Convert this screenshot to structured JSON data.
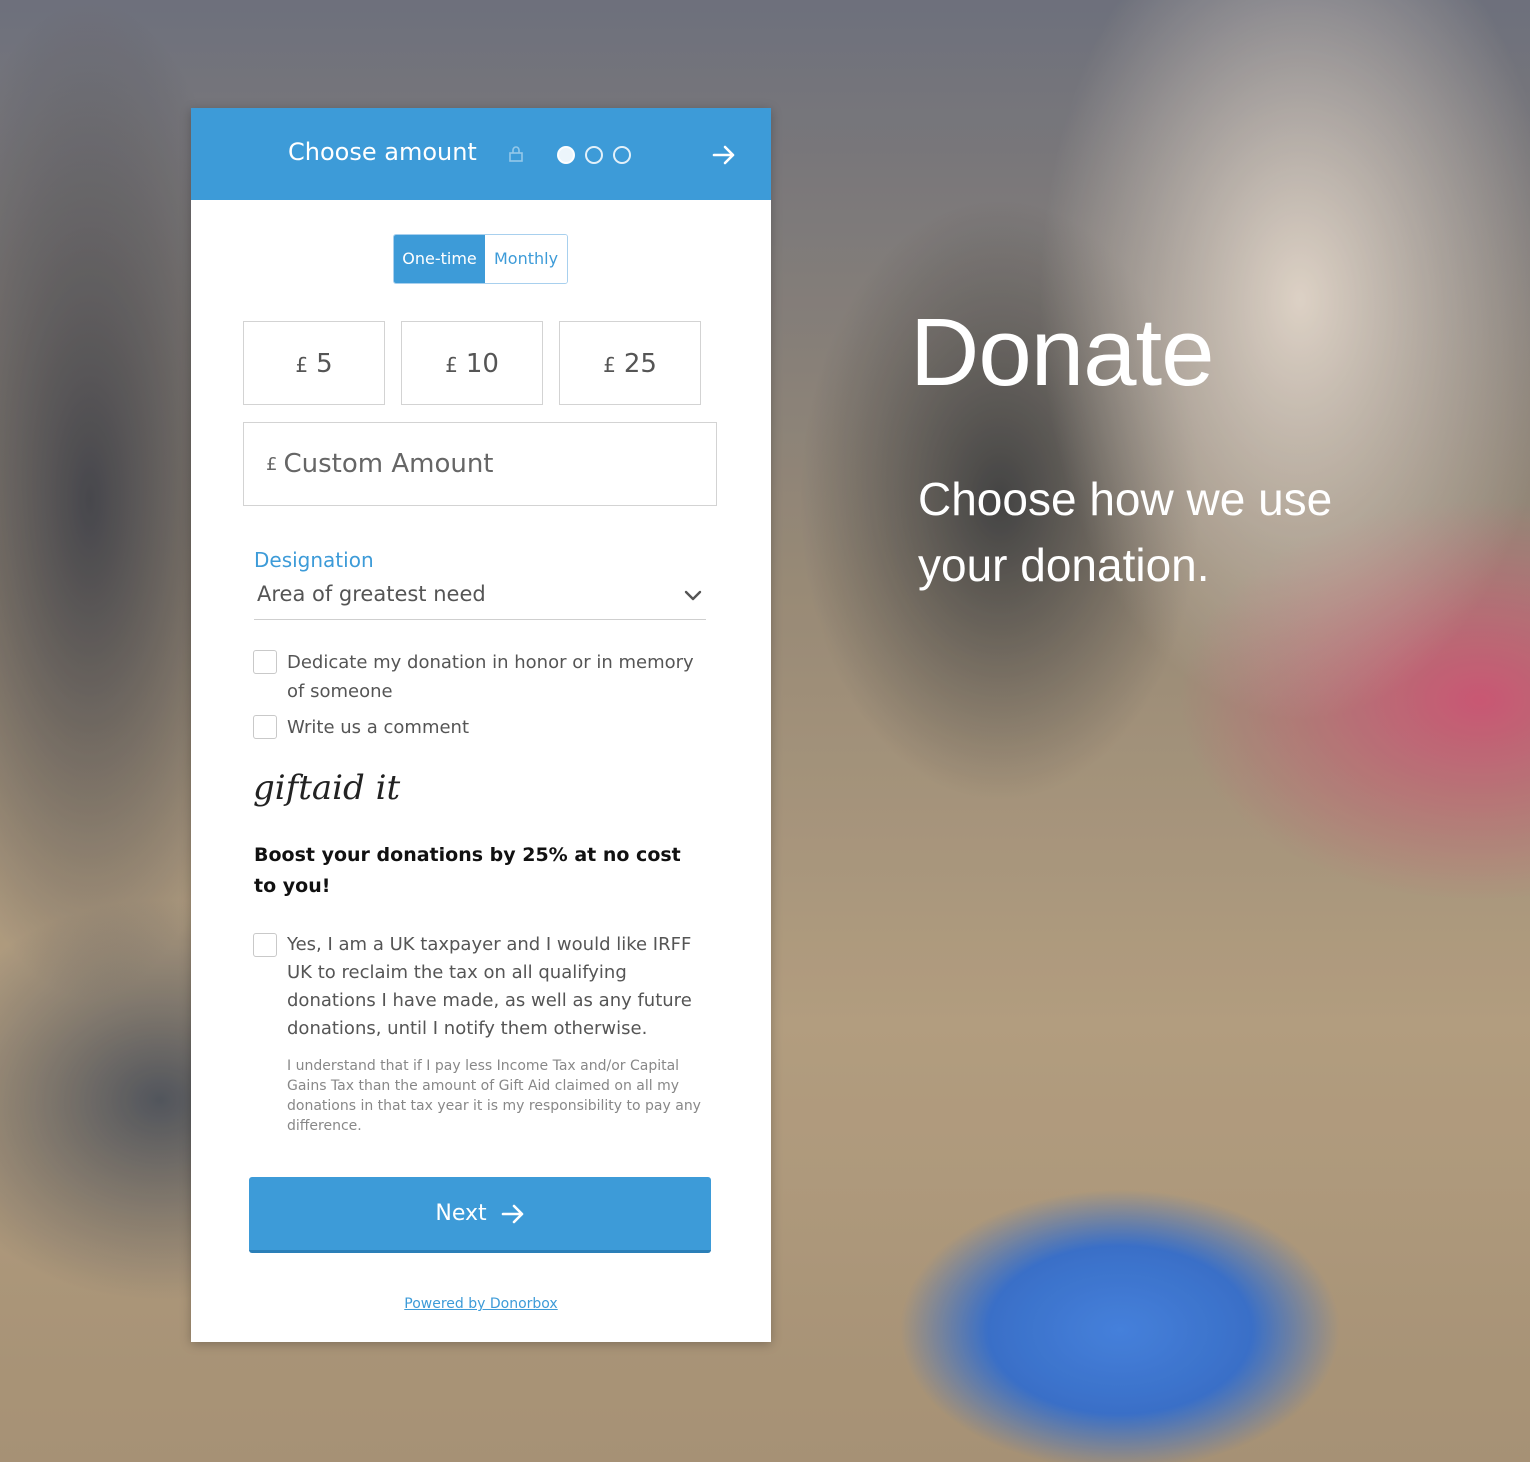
{
  "header": {
    "title": "Choose amount",
    "steps": 3,
    "active_step": 1
  },
  "frequency": {
    "one_time": "One-time",
    "monthly": "Monthly"
  },
  "currency_symbol": "£",
  "amounts": [
    "5",
    "10",
    "25"
  ],
  "custom_amount": {
    "placeholder": "Custom Amount",
    "value": ""
  },
  "designation": {
    "label": "Designation",
    "selected": "Area of greatest need"
  },
  "options": {
    "dedicate": "Dedicate my donation in honor or in memory of someone",
    "comment": "Write us a comment"
  },
  "giftaid": {
    "logo_text": "giftaid it",
    "boost": "Boost your donations by 25% at no cost to you!",
    "consent": "Yes, I am a UK taxpayer and I would like IRFF UK to reclaim the tax on all qualifying donations I have made, as well as any future donations, until I notify them otherwise.",
    "disclaimer": "I understand that if I pay less Income Tax and/or Capital Gains Tax than the amount of Gift Aid claimed on all my donations in that tax year it is my responsibility to pay any difference."
  },
  "next_label": "Next",
  "powered_by": "Powered by Donorbox",
  "hero": {
    "title": "Donate",
    "subtitle": "Choose how we use your donation."
  },
  "colors": {
    "accent": "#3d9bd8"
  }
}
